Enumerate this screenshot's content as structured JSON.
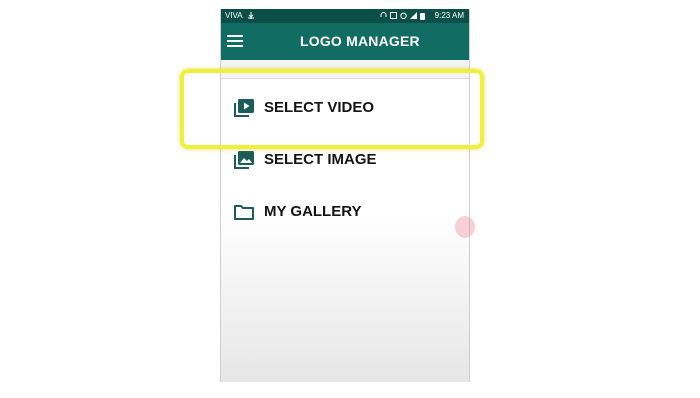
{
  "status_bar": {
    "carrier": "VIVA",
    "time": "9:23 AM",
    "icons": [
      "usb-icon",
      "headset-icon",
      "cast-icon",
      "alarm-icon",
      "signal-icon",
      "battery-icon"
    ]
  },
  "toolbar": {
    "title": "LOGO MANAGER",
    "menu_icon": "hamburger-menu-icon"
  },
  "menu": {
    "items": [
      {
        "label": "SELECT VIDEO",
        "icon": "video-library-icon"
      },
      {
        "label": "SELECT IMAGE",
        "icon": "image-library-icon"
      },
      {
        "label": "MY GALLERY",
        "icon": "folder-icon"
      }
    ]
  },
  "colors": {
    "toolbar": "#116d63",
    "status_bar": "#0b4f48",
    "icon": "#1c5d57",
    "highlight": "#f0f03a"
  }
}
